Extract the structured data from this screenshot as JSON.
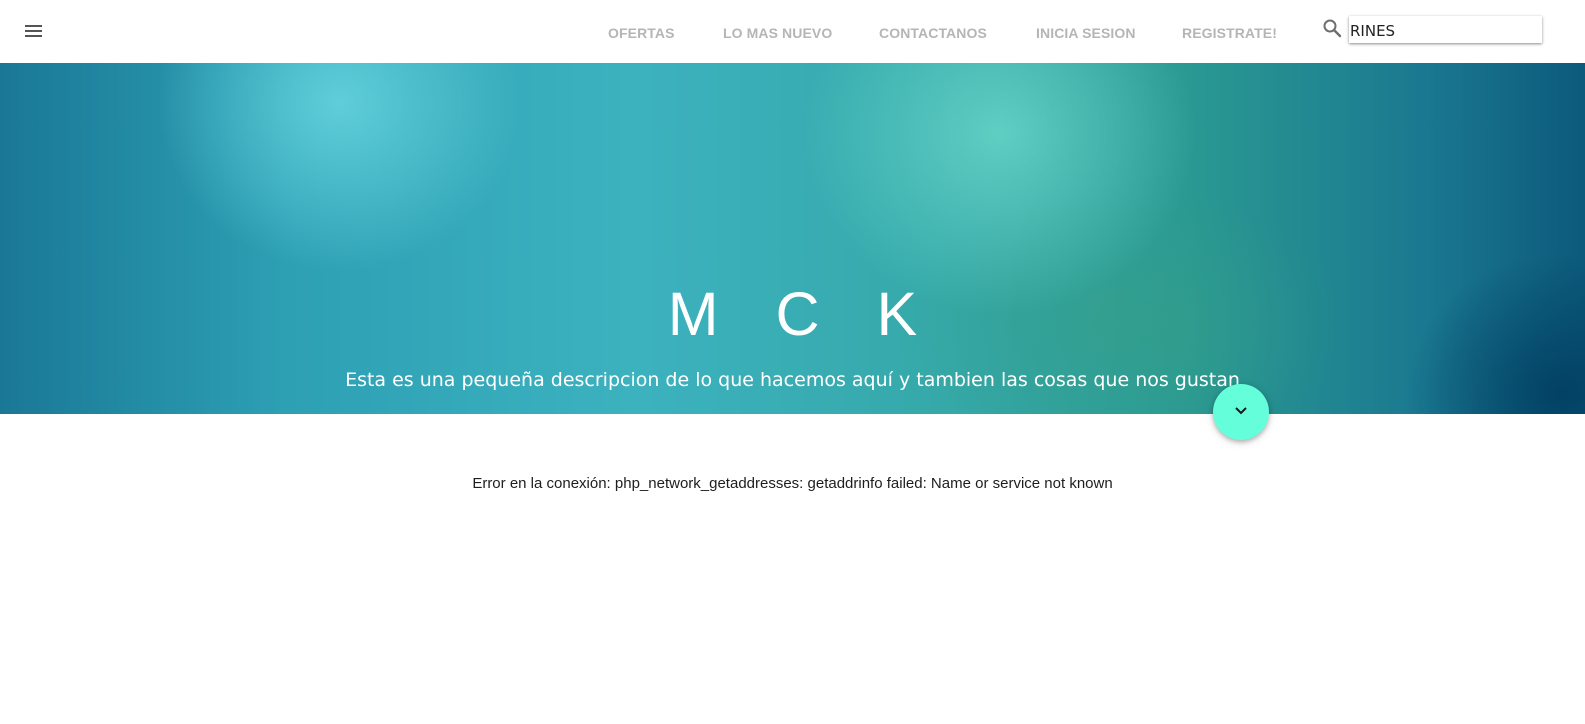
{
  "navbar": {
    "menu_icon": "menu-icon",
    "links": [
      {
        "label": "OFERTAS"
      },
      {
        "label": "LO MAS NUEVO"
      },
      {
        "label": "CONTACTANOS"
      },
      {
        "label": "INICIA SESION"
      },
      {
        "label": "REGISTRATE!"
      }
    ],
    "search": {
      "icon": "search-icon",
      "value": "RINES"
    }
  },
  "hero": {
    "title": "M C K",
    "subtitle": "Esta es una pequeña descripcion de lo que hacemos aquí y tambien las cosas que nos gustan",
    "fab_icon": "chevron-down-icon"
  },
  "content": {
    "error_message": "Error en la conexión: php_network_getaddresses: getaddrinfo failed: Name or service not known"
  },
  "colors": {
    "nav_link": "#b5b5b5",
    "fab": "#64ffda",
    "hero_text": "#ffffff"
  }
}
